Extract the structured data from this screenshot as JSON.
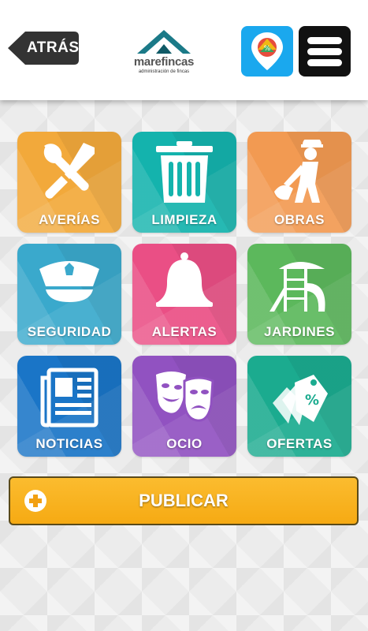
{
  "header": {
    "back_label": "ATRÁS",
    "logo_name": "marefincas",
    "logo_sub": "administración de fincas"
  },
  "tiles": [
    {
      "label": "AVERÍAS",
      "icon": "tools-icon",
      "color": "#f2a93b"
    },
    {
      "label": "LIMPIEZA",
      "icon": "trash-bin-icon",
      "color": "#14b3ad"
    },
    {
      "label": "OBRAS",
      "icon": "construction-worker-icon",
      "color": "#f29a52"
    },
    {
      "label": "SEGURIDAD",
      "icon": "police-cap-icon",
      "color": "#3aa9cc"
    },
    {
      "label": "ALERTAS",
      "icon": "bell-icon",
      "color": "#ea4f85"
    },
    {
      "label": "JARDINES",
      "icon": "playground-icon",
      "color": "#5cb85c"
    },
    {
      "label": "NOTICIAS",
      "icon": "newspaper-icon",
      "color": "#1a75c7"
    },
    {
      "label": "OCIO",
      "icon": "theater-masks-icon",
      "color": "#9152c1"
    },
    {
      "label": "OFERTAS",
      "icon": "price-tags-icon",
      "color": "#1bab8f"
    }
  ],
  "publish": {
    "label": "PUBLICAR",
    "color": "#f8b11c"
  }
}
